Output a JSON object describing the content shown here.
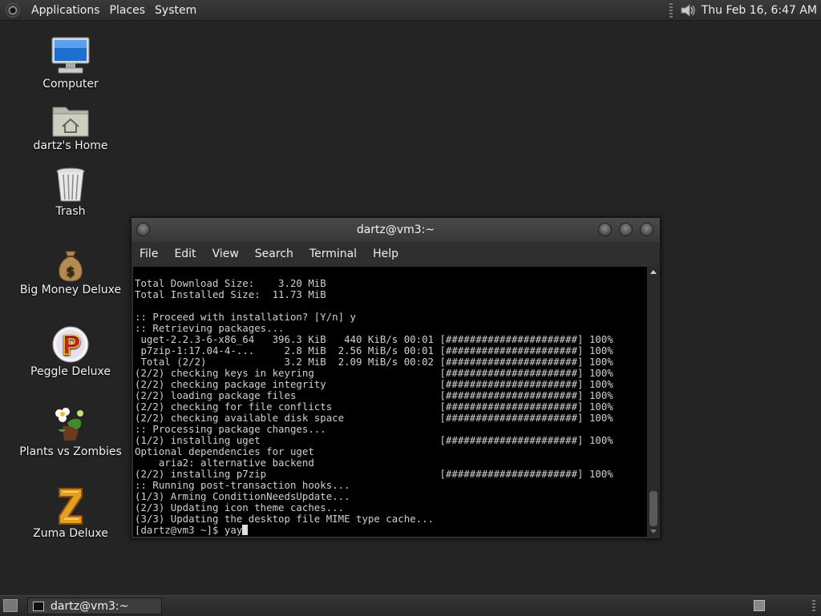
{
  "top_panel": {
    "menus": [
      "Applications",
      "Places",
      "System"
    ],
    "clock": "Thu Feb 16,  6:47 AM"
  },
  "desktop_icons": [
    {
      "label": "Computer",
      "icon": "computer-icon"
    },
    {
      "label": "dartz's Home",
      "icon": "home-folder-icon"
    },
    {
      "label": "Trash",
      "icon": "trash-icon"
    },
    {
      "label": "Big Money Deluxe",
      "icon": "money-bag-icon"
    },
    {
      "label": "Peggle Deluxe",
      "icon": "peggle-icon"
    },
    {
      "label": "Plants vs Zombies",
      "icon": "plants-icon"
    },
    {
      "label": "Zuma Deluxe",
      "icon": "zuma-icon"
    }
  ],
  "window": {
    "title": "dartz@vm3:~",
    "menus": [
      "File",
      "Edit",
      "View",
      "Search",
      "Terminal",
      "Help"
    ]
  },
  "terminal": {
    "lines": [
      "Total Download Size:    3.20 MiB",
      "Total Installed Size:  11.73 MiB",
      "",
      ":: Proceed with installation? [Y/n] y",
      ":: Retrieving packages...",
      " uget-2.2.3-6-x86_64   396.3 KiB   440 KiB/s 00:01 [######################] 100%",
      " p7zip-1:17.04-4-...     2.8 MiB  2.56 MiB/s 00:01 [######################] 100%",
      " Total (2/2)             3.2 MiB  2.09 MiB/s 00:02 [######################] 100%",
      "(2/2) checking keys in keyring                     [######################] 100%",
      "(2/2) checking package integrity                   [######################] 100%",
      "(2/2) loading package files                        [######################] 100%",
      "(2/2) checking for file conflicts                  [######################] 100%",
      "(2/2) checking available disk space                [######################] 100%",
      ":: Processing package changes...",
      "(1/2) installing uget                              [######################] 100%",
      "Optional dependencies for uget",
      "    aria2: alternative backend",
      "(2/2) installing p7zip                             [######################] 100%",
      ":: Running post-transaction hooks...",
      "(1/3) Arming ConditionNeedsUpdate...",
      "(2/3) Updating icon theme caches...",
      "(3/3) Updating the desktop file MIME type cache...",
      "[dartz@vm3 ~]$ yay"
    ]
  },
  "taskbar": {
    "task_label": "dartz@vm3:~"
  }
}
